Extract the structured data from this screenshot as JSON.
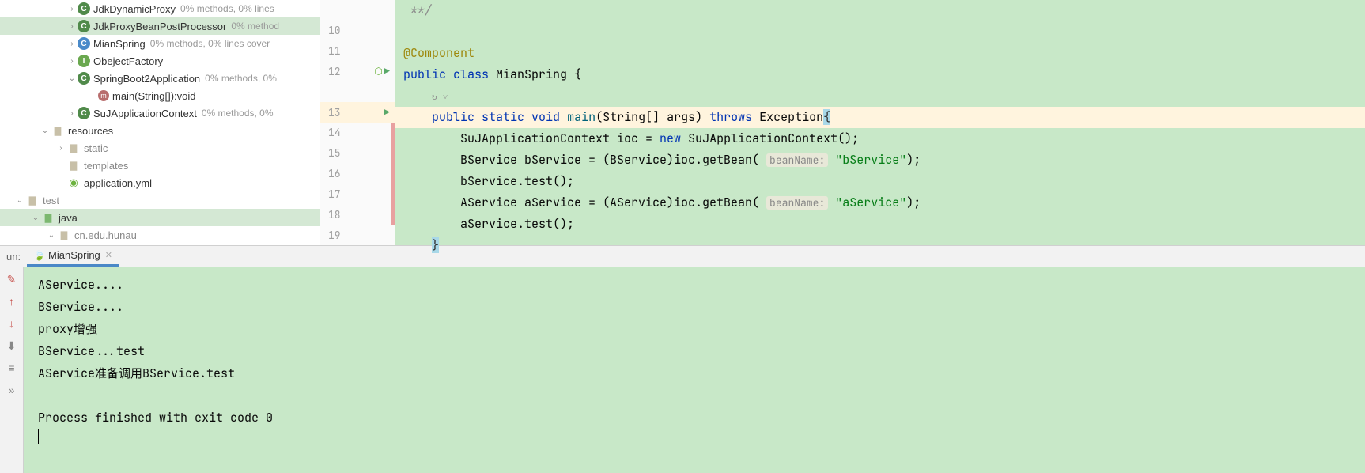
{
  "tree": {
    "items": [
      {
        "indent": 84,
        "arrow": ">",
        "iconClass": "icon-class",
        "iconText": "C",
        "label": "JdkDynamicProxy",
        "coverage": "0% methods, 0% lines"
      },
      {
        "indent": 84,
        "arrow": ">",
        "iconClass": "icon-class",
        "iconText": "C",
        "label": "JdkProxyBeanPostProcessor",
        "coverage": "0% method",
        "selected": true
      },
      {
        "indent": 84,
        "arrow": ">",
        "iconClass": "icon-class blue",
        "iconText": "C",
        "label": "MianSpring",
        "coverage": "0% methods, 0% lines cover"
      },
      {
        "indent": 84,
        "arrow": ">",
        "iconClass": "icon-class interface",
        "iconText": "I",
        "label": "ObejectFactory",
        "coverage": ""
      },
      {
        "indent": 84,
        "arrow": "v",
        "iconClass": "icon-class",
        "iconText": "C",
        "label": "SpringBoot2Application",
        "coverage": "0% methods, 0%"
      },
      {
        "indent": 110,
        "arrow": "",
        "iconClass": "icon-method",
        "iconText": "m",
        "label": "main(String[]):void",
        "coverage": ""
      },
      {
        "indent": 84,
        "arrow": ">",
        "iconClass": "icon-class",
        "iconText": "C",
        "label": "SuJApplicationContext",
        "coverage": "0% methods, 0%"
      },
      {
        "indent": 50,
        "arrow": "v",
        "iconClass": "icon-folder",
        "iconText": "📁",
        "label": "resources",
        "coverage": "",
        "folder": true
      },
      {
        "indent": 70,
        "arrow": ">",
        "iconClass": "icon-folder",
        "iconText": "📁",
        "label": "static",
        "coverage": "",
        "folder": true,
        "grey": true
      },
      {
        "indent": 70,
        "arrow": "",
        "iconClass": "icon-folder",
        "iconText": "📁",
        "label": "templates",
        "coverage": "",
        "folder": true,
        "grey": true
      },
      {
        "indent": 70,
        "arrow": "",
        "iconClass": "icon-spring",
        "iconText": "◉",
        "label": "application.yml",
        "coverage": ""
      },
      {
        "indent": 18,
        "arrow": "v",
        "iconClass": "icon-folder",
        "iconText": "📁",
        "label": "test",
        "coverage": "",
        "folder": true,
        "grey": true
      },
      {
        "indent": 38,
        "arrow": "v",
        "iconClass": "icon-folder green",
        "iconText": "📁",
        "label": "java",
        "coverage": "",
        "folder": true,
        "selected": true
      },
      {
        "indent": 58,
        "arrow": "v",
        "iconClass": "icon-folder",
        "iconText": "📁",
        "label": "cn.edu.hunau",
        "coverage": "",
        "folder": true,
        "grey": true
      }
    ]
  },
  "editor": {
    "lines": [
      {
        "num": "",
        "html": "<span class='kw-grey'> **/</span>"
      },
      {
        "num": "10",
        "html": ""
      },
      {
        "num": "11",
        "html": "<span class='kw-olive'>@Component</span>"
      },
      {
        "num": "12",
        "run": true,
        "html": "<span class='kw-blue'>public class</span> <span class='txt-black'>MianSpring {</span>"
      },
      {
        "num": "",
        "html": "    <span class='kw-grey' style='font-size:11px'>↻ ˅</span>"
      },
      {
        "num": "13",
        "run": "single",
        "highlighted": true,
        "html": "    <span class='kw-blue'>public static</span> <span class='kw-blue'>void</span> <span class='txt-method'>main</span><span class='txt-black'>(String[] args) </span><span class='kw-blue'>throws</span> <span class='txt-black'>Exception</span><span class='caret-bg'>{</span>"
      },
      {
        "num": "14",
        "cov": "red",
        "html": "        <span class='txt-black'>SuJApplicationContext ioc = </span><span class='kw-blue'>new</span> <span class='txt-black'>SuJApplicationContext();</span>"
      },
      {
        "num": "15",
        "cov": "red",
        "html": "        <span class='txt-black'>BService bService = (BService)ioc.getBean(</span> <span class='hint'>beanName:</span> <span class='kw-green'>\"bService\"</span><span class='txt-black'>);</span>"
      },
      {
        "num": "16",
        "cov": "red",
        "html": "        <span class='txt-black'>bService.test();</span>"
      },
      {
        "num": "17",
        "cov": "red",
        "html": "        <span class='txt-black'>AService aService = (AService)ioc.getBean(</span> <span class='hint'>beanName:</span> <span class='kw-green'>\"aService\"</span><span class='txt-black'>);</span>"
      },
      {
        "num": "18",
        "cov": "red",
        "html": "        <span class='txt-black'>aService.test();</span>"
      },
      {
        "num": "19",
        "html": "    <span class='caret-bg'>}</span>"
      }
    ]
  },
  "runPanel": {
    "label": "un:",
    "tabName": "MianSpring",
    "console": "AService....\nBService....\nproxy增强\nBService...test\nAService准备调用BService.test\n\nProcess finished with exit code 0"
  },
  "toolbar": {
    "icons": [
      "✎",
      "↑",
      "↓",
      "⬇",
      "≡",
      "»"
    ]
  }
}
